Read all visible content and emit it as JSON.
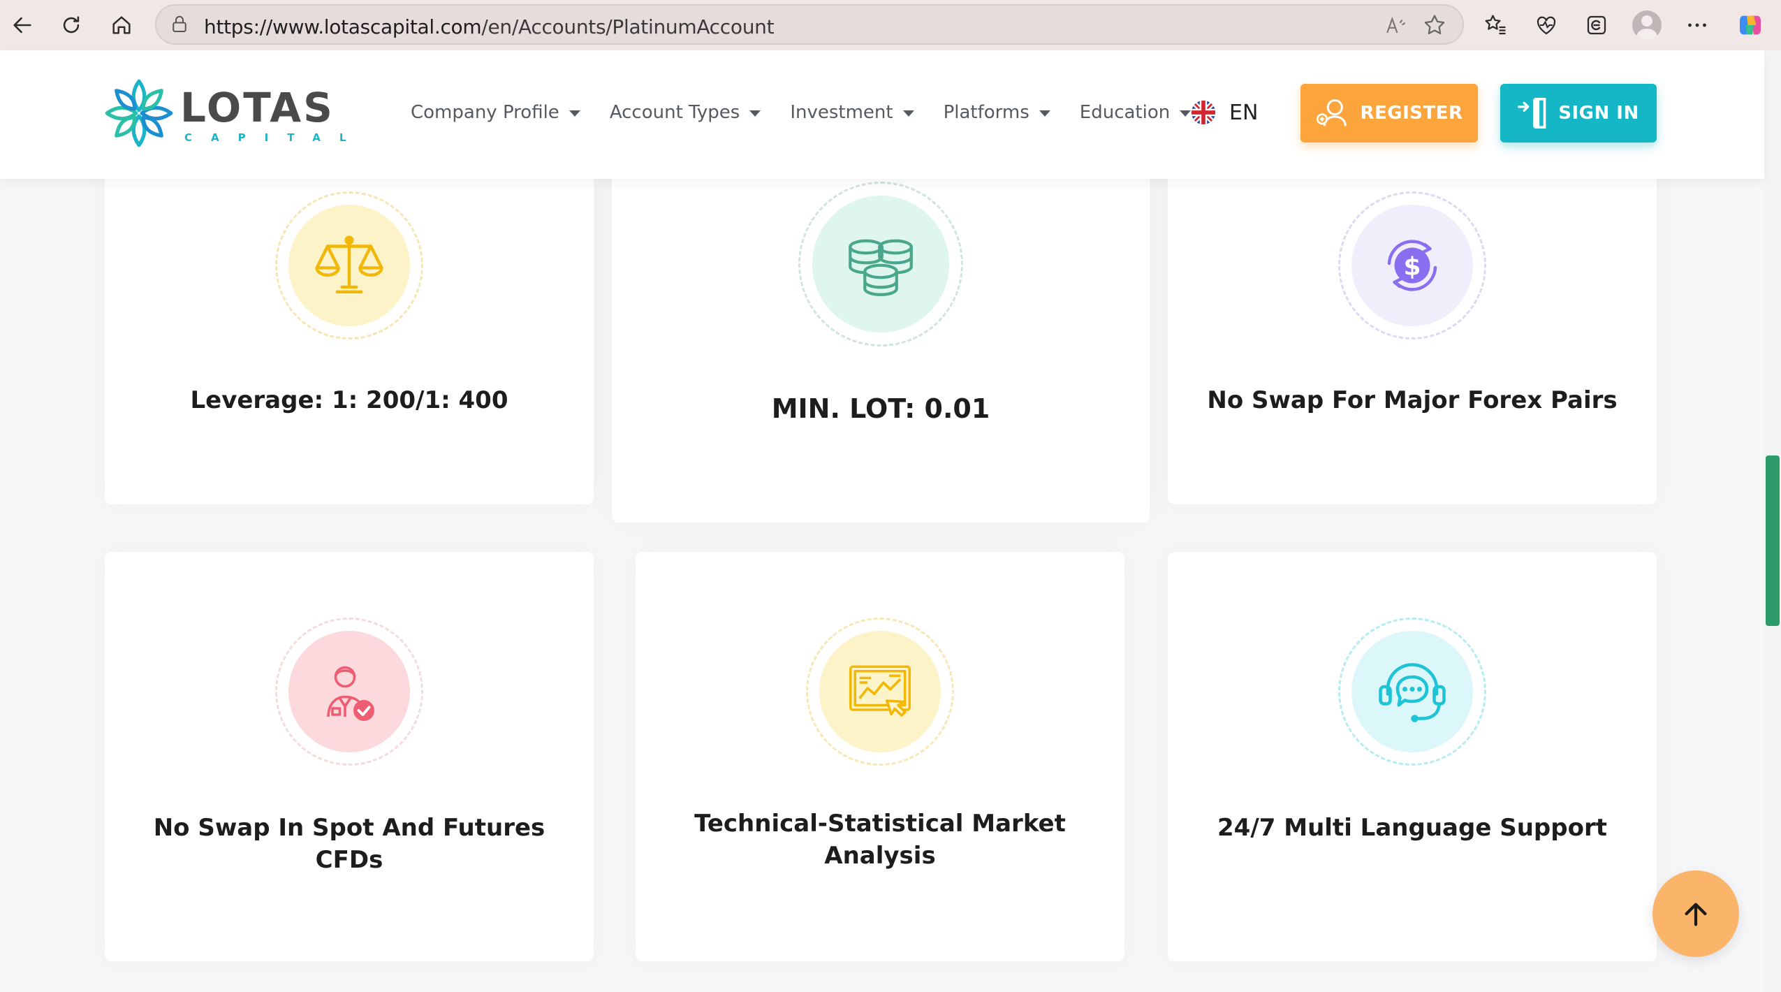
{
  "browser": {
    "url_host": "https://www.lotascapital.com",
    "url_path": "/en/Accounts/PlatinumAccount"
  },
  "brand": {
    "name": "LOTAS",
    "tagline": "CAPITAL",
    "accent": "#1cb4c9"
  },
  "nav": {
    "items": [
      {
        "label": "Company Profile"
      },
      {
        "label": "Account Types"
      },
      {
        "label": "Investment"
      },
      {
        "label": "Platforms"
      },
      {
        "label": "Education"
      }
    ],
    "language": "EN",
    "register_label": "REGISTER",
    "signin_label": "SIGN IN",
    "register_color": "#fba53c",
    "signin_color": "#15b6c6"
  },
  "features": [
    {
      "title": "Leverage: 1: 200/1: 400",
      "icon": "scale-icon"
    },
    {
      "title": "MIN. LOT: 0.01",
      "icon": "coins-icon"
    },
    {
      "title": "No Swap For Major Forex Pairs",
      "icon": "dollar-exchange-icon"
    },
    {
      "title": "No Swap In Spot And Futures CFDs",
      "icon": "verified-user-icon"
    },
    {
      "title": "Technical-Statistical Market Analysis",
      "icon": "analysis-screen-icon"
    },
    {
      "title": "24/7 Multi Language Support",
      "icon": "support-headset-icon"
    }
  ]
}
